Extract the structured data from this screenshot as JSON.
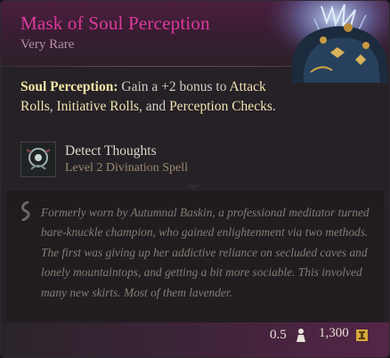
{
  "item": {
    "name": "Mask of Soul Perception",
    "rarity": "Very Rare",
    "art_icon": "ornate-mask-item-icon"
  },
  "passive": {
    "name": "Soul Perception:",
    "text_part1": " Gain a +2 bonus to ",
    "highlight1": "Attack Rolls",
    "text_part2": ", ",
    "highlight2": "Initiative Rolls",
    "text_part3": ", and ",
    "highlight3": "Perception Checks",
    "text_part4": "."
  },
  "spell": {
    "icon": "detect-thoughts-spell-icon",
    "name": "Detect Thoughts",
    "subtitle": "Level 2 Divination Spell"
  },
  "lore": {
    "icon": "quill-icon",
    "text": "Formerly worn by Autumnal Baskin, a professional meditator turned bare-knuckle champion, who gained enlightenment via two methods. The first was giving up her addictive reliance on secluded caves and lonely mountaintops, and getting a bit more sociable. This involved many new skirts. Most of them lavender."
  },
  "footer": {
    "weight": "0.5",
    "weight_icon": "weight-icon",
    "value": "1,300",
    "value_icon": "gold-coin-icon"
  },
  "colors": {
    "title": "#e0389d",
    "rarity": "#b58da5",
    "passive_name": "#f2e6a6",
    "lore_text": "#857c72"
  }
}
